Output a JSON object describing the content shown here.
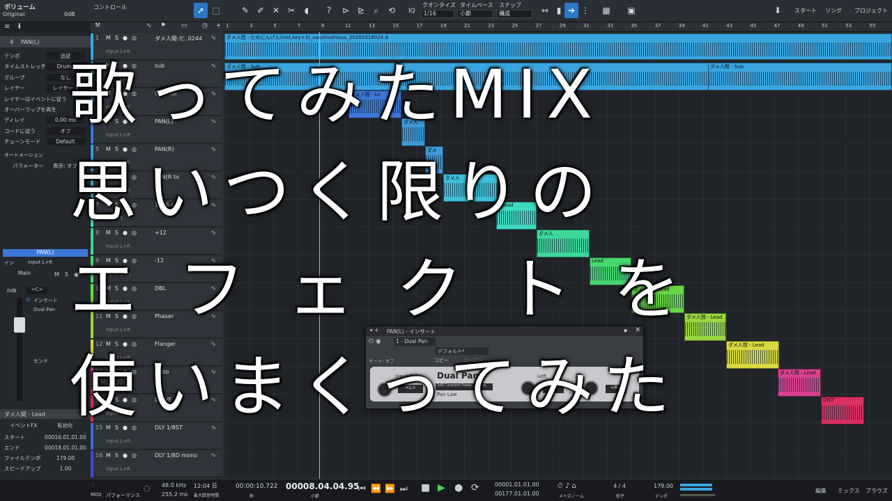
{
  "toolbar": {
    "track_name": "ボリューム",
    "preset": "Original",
    "volume": "0dB",
    "control_label": "コントロール",
    "quantize_label": "クオンタイズ",
    "quantize_value": "1/16",
    "timebase_label": "タイムベース",
    "timebase_value": "小節",
    "snap_label": "スナップ",
    "snap_value": "構成",
    "iq_label": "IQ",
    "start_label": "スタート",
    "song_label": "ソング",
    "project_label": "プロジェクト"
  },
  "inspector": {
    "track_header": "PAN(L)",
    "track_number": "4",
    "rows": [
      {
        "k": "テンポ",
        "v": "追従"
      },
      {
        "k": "タイムストレッチ",
        "v": "Drums"
      },
      {
        "k": "グループ",
        "v": "なし"
      },
      {
        "k": "レイヤー",
        "v": "レイヤー 1"
      },
      {
        "k": "レイヤーはイベントに従う",
        "v": ""
      },
      {
        "k": "オーバーラップを再生",
        "v": ""
      },
      {
        "k": "ディレイ",
        "v": "0.00 ms"
      },
      {
        "k": "コードに従う",
        "v": "オフ"
      },
      {
        "k": "チューンモード",
        "v": "Default"
      }
    ],
    "automation_label": "オートメーション",
    "param_label": "パラメーター",
    "param_value": "表示: オフ"
  },
  "mixer": {
    "channel_name": "PAN(L)",
    "input_label": "イン",
    "input_value": "Input L+R",
    "main_label": "Main",
    "fader_value": "0dB",
    "pan_value": "<C>",
    "insert_label": "インサート",
    "insert_plugin": "Dual Pan",
    "send_label": "センド"
  },
  "event": {
    "name": "ダメ人間 - Lead",
    "fx_label": "イベントFX",
    "fx_value": "有効化",
    "rows": [
      {
        "k": "スタート",
        "v": "00016.01.01.00"
      },
      {
        "k": "エンド",
        "v": "00018.01.01.00"
      },
      {
        "k": "ファイルテンポ",
        "v": "179.00"
      },
      {
        "k": "スピードアップ",
        "v": "1.00"
      }
    ]
  },
  "tracks": [
    {
      "num": "1",
      "name": "ダメ人間-だ..0244",
      "input": "Input L+R",
      "color": "#3aa6e0"
    },
    {
      "num": "2",
      "name": "sub",
      "input": "Input L+R",
      "color": "#3aa6e0"
    },
    {
      "num": "3",
      "name": "Original",
      "input": "Input L+R",
      "color": "#3aa6e0"
    },
    {
      "num": "4",
      "name": "PAN(L)",
      "input": "Input L+R",
      "color": "#3d78d8"
    },
    {
      "num": "5",
      "name": "PAN(R)",
      "input": "Input L+R",
      "color": "#3d9ad8"
    },
    {
      "num": "6",
      "name": "PAN(R to",
      "input": "Input L+R",
      "color": "#3dc0d8"
    },
    {
      "num": "7",
      "name": "1176 all",
      "input": "Input 1",
      "color": "#3dd8c0"
    },
    {
      "num": "8",
      "name": "+12",
      "input": "Input L+R",
      "color": "#3dd89a"
    },
    {
      "num": "9",
      "name": "-12",
      "input": "Input L+R",
      "color": "#46d870"
    },
    {
      "num": "10",
      "name": "DBL",
      "input": "Input L+R",
      "color": "#6ad846"
    },
    {
      "num": "11",
      "name": "Phaser",
      "input": "Input L+R",
      "color": "#9ad840"
    },
    {
      "num": "12",
      "name": "Flanger",
      "input": "Input L+R",
      "color": "#d8d840"
    },
    {
      "num": "13",
      "name": "radio",
      "input": "Input L+R",
      "color": "#d84090"
    },
    {
      "num": "14",
      "name": "DRIVE",
      "input": "Input 1",
      "color": "#d83060"
    },
    {
      "num": "15",
      "name": "DLY 1/8ST",
      "input": "Input L+R",
      "color": "#3a6ad8"
    },
    {
      "num": "16",
      "name": "DLY 1/8D mono",
      "input": "Input L+R",
      "color": "#3a4ad8"
    }
  ],
  "ruler": [
    "1",
    "3",
    "5",
    "7",
    "9",
    "11",
    "13",
    "15",
    "17",
    "19",
    "21",
    "23",
    "25",
    "27",
    "29",
    "31",
    "33",
    "35",
    "37",
    "39",
    "41",
    "43",
    "45",
    "47",
    "49",
    "51",
    "53",
    "55"
  ],
  "clips": [
    {
      "label": "ダメ人間 - だめにんげん(inst,key+3)_usushioshisuu_20200318024 4",
      "color": "#3aa6e0"
    },
    {
      "label": "ダメ人間 - Sub",
      "color": "#3aa6e0"
    },
    {
      "label": "ダメ人間 - Sub",
      "color": "#3aa6e0"
    },
    {
      "label": "ダメ人間 - Le",
      "color": "#3d78d8"
    },
    {
      "label": "ダメ人",
      "color": "#3d9ad8"
    },
    {
      "label": "ダメ",
      "color": "#3d9ad8"
    },
    {
      "label": "ダメ人",
      "color": "#3dc0d8"
    },
    {
      "label": "- Lead",
      "color": "#3dd8c0"
    },
    {
      "label": "ダメ人",
      "color": "#3dd89a"
    },
    {
      "label": "Lead",
      "color": "#46d870"
    },
    {
      "label": "ダメ人間 - Lead",
      "color": "#6ad846"
    },
    {
      "label": "ダメ人間 - Lead",
      "color": "#9ad840"
    },
    {
      "label": "ダメ人間 - Lead",
      "color": "#d8d840"
    },
    {
      "label": "ダメ人間 - Lead",
      "color": "#d84090"
    },
    {
      "label": "DIST",
      "color": "#d83060"
    }
  ],
  "plugin": {
    "title": "PAN(L) - インサート",
    "slot": "1 - Dual Pan",
    "preset": "デフォルト*",
    "auto_label": "オート: オフ",
    "copy_label": "コピー",
    "paste_label": "ペースト",
    "input_bal": "Input Bal.",
    "brand": "Dual Pan",
    "pan_law": "Pan Law",
    "pan_law_value": "-3dB Constant Power Sin/Cos",
    "left": "Left",
    "left_value": "<L>",
    "right_value": "<R>",
    "bal_value": "<L>",
    "link": "Link"
  },
  "overlay": {
    "line1": "歌ってみたMIX",
    "line2": "思いつく限りの",
    "line3": "エフェクトを",
    "line4": "使いまくってみた"
  },
  "transport": {
    "midi": "MIDI",
    "perf": "パフォーマンス",
    "rate": "48.0 kHz",
    "latency": "255.2 ms",
    "rec_time": "12:04 日",
    "rec_label": "最大録音時間",
    "seconds": "00:00:10.722",
    "seconds_label": "秒",
    "bars": "00008.04.04.95",
    "bars_label": "小節",
    "loop_l": "00001.01.01.00",
    "loop_r": "00177.01.01.00",
    "metronome": "メトロノーム",
    "sig": "4 / 4",
    "sig_label": "拍子",
    "tempo": "179.00",
    "tempo_label": "テンポ",
    "edit": "編集",
    "mix": "ミックス",
    "browse": "ブラウズ"
  }
}
